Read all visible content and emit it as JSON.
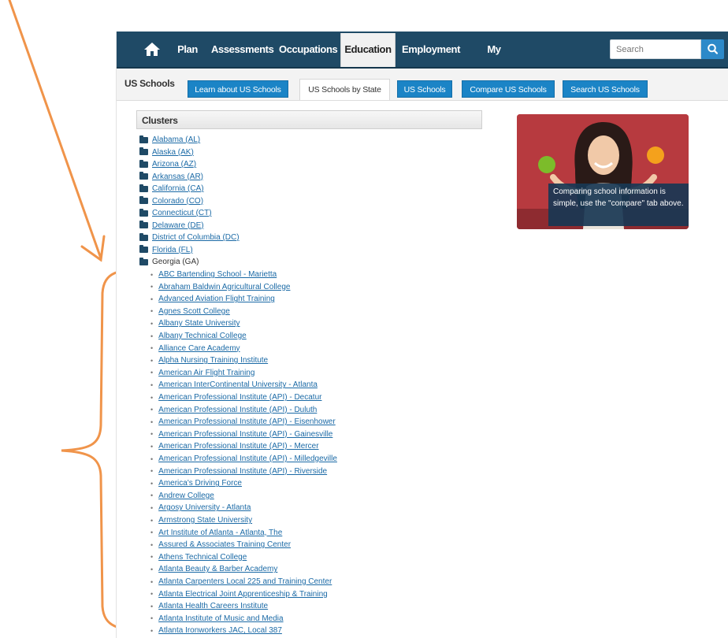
{
  "nav": {
    "items": [
      "Plan",
      "Assessments",
      "Occupations",
      "Education",
      "Employment",
      "My Portfolio"
    ],
    "active": "Education",
    "search_placeholder": "Search"
  },
  "subnav": {
    "title": "US Schools",
    "tabs": [
      "Learn about US Schools",
      "US Schools by State",
      "US Schools",
      "Compare US Schools",
      "Search US Schools"
    ],
    "active_tab": "US Schools by State"
  },
  "clusters_title": "Clusters",
  "states": [
    "Alabama (AL)",
    "Alaska (AK)",
    "Arizona (AZ)",
    "Arkansas (AR)",
    "California (CA)",
    "Colorado (CO)",
    "Connecticut (CT)",
    "Delaware (DE)",
    "District of Columbia (DC)",
    "Florida (FL)",
    "Georgia (GA)"
  ],
  "expanded_state": "Georgia (GA)",
  "schools": [
    "ABC Bartending School - Marietta",
    "Abraham Baldwin Agricultural College",
    "Advanced Aviation Flight Training",
    "Agnes Scott College",
    "Albany State University",
    "Albany Technical College",
    "Alliance Care Academy",
    "Alpha Nursing Training Institute",
    "American Air Flight Training",
    "American InterContinental University - Atlanta",
    "American Professional Institute (API) - Decatur",
    "American Professional Institute (API) - Duluth",
    "American Professional Institute (API) - Eisenhower",
    "American Professional Institute (API) - Gainesville",
    "American Professional Institute (API) - Mercer",
    "American Professional Institute (API) - Milledgeville",
    "American Professional Institute (API) - Riverside",
    "America's Driving Force",
    "Andrew College",
    "Argosy University - Atlanta",
    "Armstrong State University",
    "Art Institute of Atlanta - Atlanta, The",
    "Assured & Associates Training Center",
    "Athens Technical College",
    "Atlanta Beauty & Barber Academy",
    "Atlanta Carpenters Local 225 and Training Center",
    "Atlanta Electrical Joint Apprenticeship & Training",
    "Atlanta Health Careers Institute",
    "Atlanta Institute of Music and Media",
    "Atlanta Ironworkers JAC, Local 387"
  ],
  "promo": {
    "caption": "Comparing school information is simple, use the \"compare\" tab above."
  },
  "colors": {
    "nav_bg": "#1f4a66",
    "tab_blue": "#1b84c6",
    "link": "#1b6aa6",
    "annotation": "#f0944a"
  }
}
